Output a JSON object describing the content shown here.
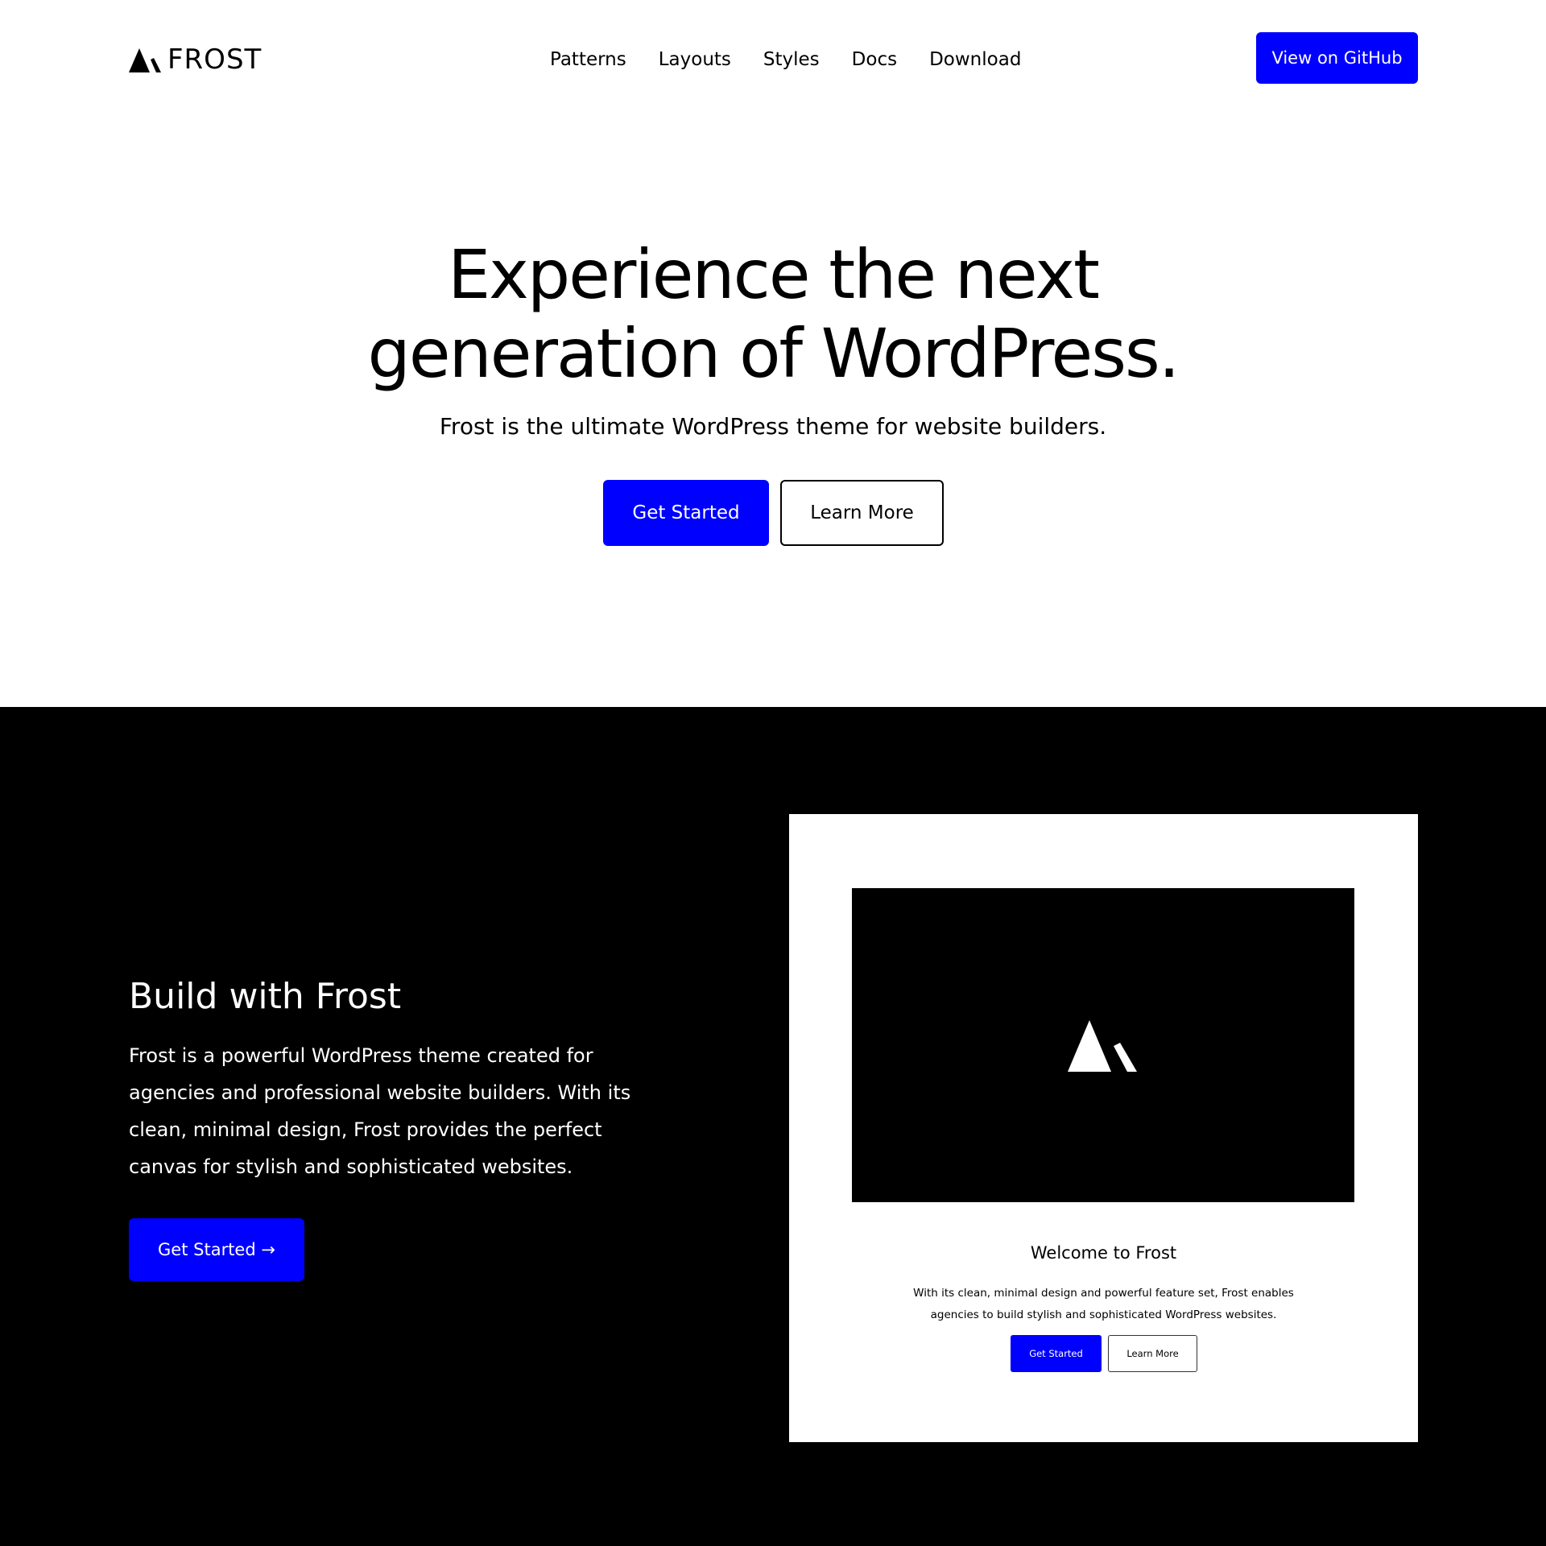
{
  "header": {
    "logo_text": "FROST",
    "nav": [
      "Patterns",
      "Layouts",
      "Styles",
      "Docs",
      "Download"
    ],
    "cta_label": "View on GitHub"
  },
  "hero": {
    "title_line1": "Experience the next",
    "title_line2": "generation of WordPress.",
    "subtitle": "Frost is the ultimate WordPress theme for website builders.",
    "primary_label": "Get Started",
    "secondary_label": "Learn More"
  },
  "build": {
    "title": "Build with Frost",
    "text": "Frost is a powerful WordPress theme created for agencies and professional website builders. With its clean, minimal design, Frost provides the perfect canvas for stylish and sophisticated websites.",
    "button_label": "Get Started →"
  },
  "preview": {
    "title": "Welcome to Frost",
    "text": "With its clean, minimal design and powerful feature set, Frost enables agencies to build stylish and sophisticated WordPress websites.",
    "primary_label": "Get Started",
    "secondary_label": "Learn More"
  },
  "colors": {
    "accent": "#0000ff",
    "dark_background": "#000000",
    "page_background": "#ffffff"
  },
  "icons": {
    "logo": "frost-mountain-icon"
  }
}
